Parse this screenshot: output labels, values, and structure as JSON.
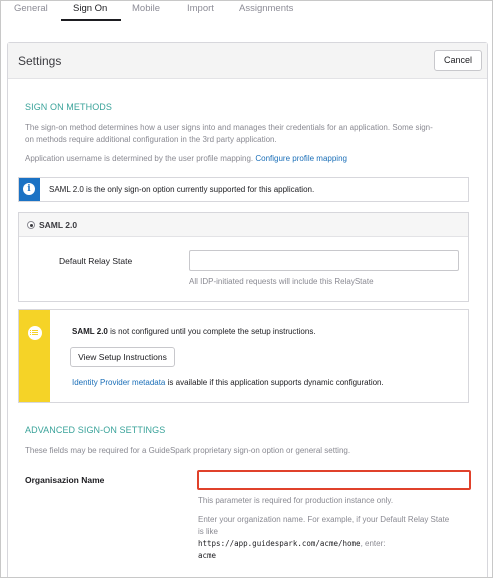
{
  "tabs": [
    {
      "label": "General"
    },
    {
      "label": "Sign On"
    },
    {
      "label": "Mobile"
    },
    {
      "label": "Import"
    },
    {
      "label": "Assignments"
    }
  ],
  "active_tab": "Sign On",
  "settings": {
    "title": "Settings",
    "cancel_label": "Cancel"
  },
  "sign_on_methods": {
    "heading": "SIGN ON METHODS",
    "description_line1": "The sign-on method determines how a user signs into and manages their credentials for an application. Some sign-",
    "description_line2": "on methods require additional configuration in the 3rd party application.",
    "username_text": "Application username is determined by the user profile mapping.",
    "username_link": "Configure profile mapping",
    "info_text": "SAML 2.0 is the only sign-on option currently supported for this application."
  },
  "saml": {
    "radio_label": "SAML 2.0",
    "relay_state_label": "Default Relay State",
    "relay_state_value": "",
    "relay_state_hint": "All IDP-initiated requests will include this RelayState"
  },
  "warning": {
    "bold": "SAML 2.0",
    "text": " is not configured until you complete the setup instructions.",
    "button_label": "View Setup Instructions",
    "metadata_link": "Identity Provider metadata",
    "metadata_text": " is available if this application supports dynamic configuration."
  },
  "advanced": {
    "heading": "ADVANCED SIGN-ON SETTINGS",
    "description": "These fields may be required for a GuideSpark proprietary sign-on option or general setting.",
    "org_label": "Organisazion Name",
    "org_value": "",
    "org_hint": "This parameter is required for production instance only.",
    "help_line1": "Enter your organization name. For example, if your Default Relay State",
    "help_line2": "is like",
    "help_url": "https://app.guidespark.com/acme/home",
    "help_enter": ", enter:",
    "help_value": "acme"
  },
  "colors": {
    "accent_teal": "#3aa39a",
    "link_blue": "#1b6fb8",
    "info_blue": "#1b72c4",
    "warning_yellow": "#f5d327",
    "error_red": "#e0412b"
  },
  "icons": [
    "info-icon",
    "list-icon"
  ]
}
